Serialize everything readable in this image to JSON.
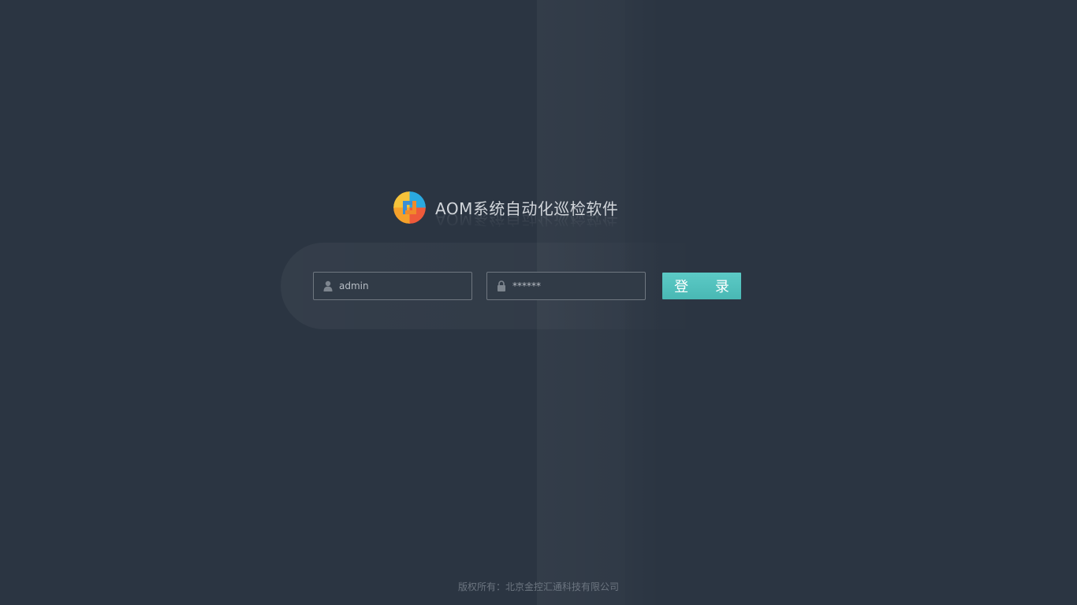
{
  "app": {
    "title": "AOM系统自动化巡检软件",
    "logo_icon": "aom-logo-icon"
  },
  "login": {
    "username": {
      "value": "admin",
      "icon": "user-icon"
    },
    "password": {
      "value": "******",
      "icon": "lock-icon"
    },
    "submit_label": "登 录"
  },
  "footer": {
    "copyright": "版权所有：北京金控汇通科技有限公司"
  },
  "colors": {
    "background": "#2b3542",
    "button": "#52c1bd",
    "title_text": "#d2d6db",
    "footer_text": "#6c7580"
  }
}
